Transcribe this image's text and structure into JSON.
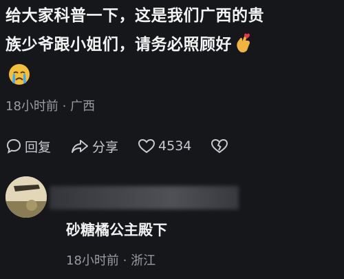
{
  "comment": {
    "line1": "给大家科普一下，这是我们广西的贵",
    "line2": "族少爷跟小姐们，请务必照顾好",
    "emoji_1": "finger-heart",
    "emoji_2": "crying-face"
  },
  "meta": {
    "time": "18小时前",
    "separator": "·",
    "location": "广西"
  },
  "actions": {
    "reply_label": "回复",
    "share_label": "分享",
    "like_count": "4534"
  },
  "reply": {
    "text": "砂糖橘公主殿下",
    "time": "18小时前",
    "separator": "·",
    "location": "浙江"
  },
  "colors": {
    "background": "#16171b",
    "text": "#f4f4f4",
    "meta": "#9b9ca2"
  }
}
